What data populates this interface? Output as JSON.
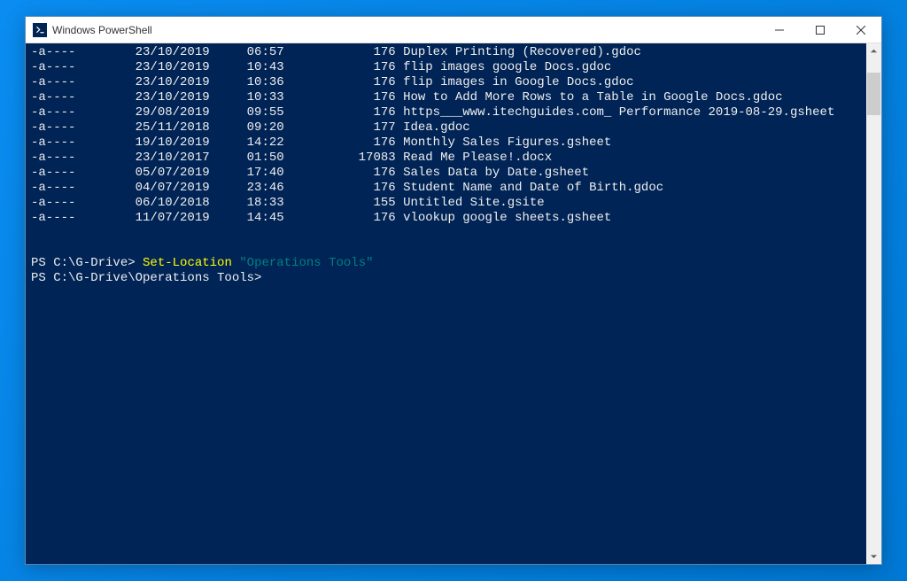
{
  "window": {
    "title": "Windows PowerShell"
  },
  "listing": [
    {
      "mode": "-a----",
      "date": "23/10/2019",
      "time": "06:57",
      "size": "176",
      "name": "Duplex Printing (Recovered).gdoc"
    },
    {
      "mode": "-a----",
      "date": "23/10/2019",
      "time": "10:43",
      "size": "176",
      "name": "flip images google Docs.gdoc"
    },
    {
      "mode": "-a----",
      "date": "23/10/2019",
      "time": "10:36",
      "size": "176",
      "name": "flip images in Google Docs.gdoc"
    },
    {
      "mode": "-a----",
      "date": "23/10/2019",
      "time": "10:33",
      "size": "176",
      "name": "How to Add More Rows to a Table in Google Docs.gdoc"
    },
    {
      "mode": "-a----",
      "date": "29/08/2019",
      "time": "09:55",
      "size": "176",
      "name": "https___www.itechguides.com_ Performance 2019-08-29.gsheet"
    },
    {
      "mode": "-a----",
      "date": "25/11/2018",
      "time": "09:20",
      "size": "177",
      "name": "Idea.gdoc"
    },
    {
      "mode": "-a----",
      "date": "19/10/2019",
      "time": "14:22",
      "size": "176",
      "name": "Monthly Sales Figures.gsheet"
    },
    {
      "mode": "-a----",
      "date": "23/10/2017",
      "time": "01:50",
      "size": "17083",
      "name": "Read Me Please!.docx"
    },
    {
      "mode": "-a----",
      "date": "05/07/2019",
      "time": "17:40",
      "size": "176",
      "name": "Sales Data by Date.gsheet"
    },
    {
      "mode": "-a----",
      "date": "04/07/2019",
      "time": "23:46",
      "size": "176",
      "name": "Student Name and Date of Birth.gdoc"
    },
    {
      "mode": "-a----",
      "date": "06/10/2018",
      "time": "18:33",
      "size": "155",
      "name": "Untitled Site.gsite"
    },
    {
      "mode": "-a----",
      "date": "11/07/2019",
      "time": "14:45",
      "size": "176",
      "name": "vlookup google sheets.gsheet"
    }
  ],
  "commands": {
    "prompt1": "PS C:\\G-Drive> ",
    "cmdlet": "Set-Location",
    "space": " ",
    "argument": "\"Operations Tools\"",
    "prompt2": "PS C:\\G-Drive\\Operations Tools>"
  }
}
